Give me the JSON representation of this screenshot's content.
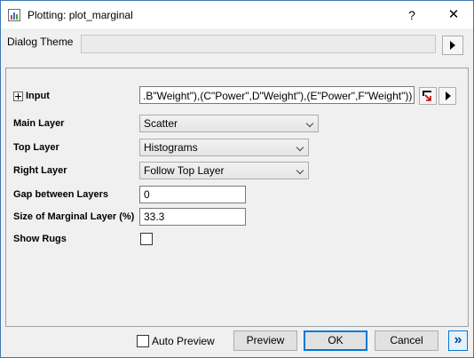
{
  "window": {
    "title": "Plotting: plot_marginal",
    "help_label": "?",
    "close_label": "✕"
  },
  "theme": {
    "label": "Dialog Theme",
    "value": ""
  },
  "form": {
    "input_label": "Input",
    "input_value": ".B\"Weight\"),(C\"Power\",D\"Weight\"),(E\"Power\",F\"Weight\"))",
    "main_layer_label": "Main Layer",
    "main_layer_value": "Scatter",
    "top_layer_label": "Top Layer",
    "top_layer_value": "Histograms",
    "right_layer_label": "Right Layer",
    "right_layer_value": "Follow Top Layer",
    "gap_label": "Gap between Layers",
    "gap_value": "0",
    "size_label": "Size of Marginal Layer (%)",
    "size_value": "33.3",
    "rugs_label": "Show Rugs",
    "rugs_checked": false
  },
  "footer": {
    "auto_preview_label": "Auto Preview",
    "auto_preview_checked": false,
    "preview_label": "Preview",
    "ok_label": "OK",
    "cancel_label": "Cancel",
    "expand_label": "»"
  },
  "colors": {
    "accent": "#0078d7",
    "window_border": "#3c78b4",
    "background": "#f0f0f0"
  }
}
